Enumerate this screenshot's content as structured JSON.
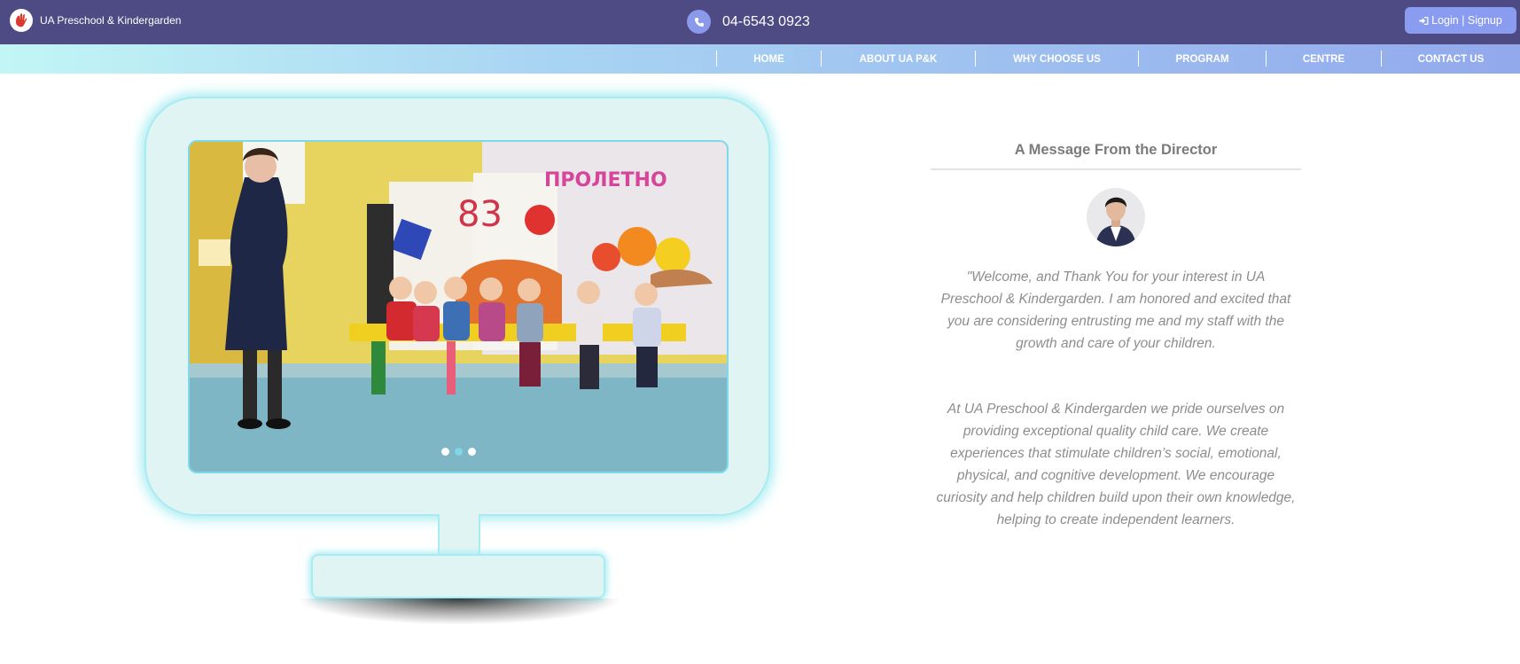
{
  "header": {
    "brand_name": "UA Preschool & Kindergarden",
    "logo_icon": "hand-logo-icon",
    "phone_icon": "phone-icon",
    "phone_number": "04-6543 0923",
    "login_icon": "sign-in-icon",
    "login_label": "Login | Signup"
  },
  "nav": {
    "items": [
      {
        "label": "HOME"
      },
      {
        "label": "ABOUT UA P&K"
      },
      {
        "label": "WHY CHOOSE US"
      },
      {
        "label": "PROGRAM"
      },
      {
        "label": "CENTRE"
      },
      {
        "label": "CONTACT US"
      }
    ]
  },
  "slider": {
    "slide_count": 3,
    "active_slide": 2,
    "classroom_letters": "ПРОЛЕТНО",
    "classroom_number": "83"
  },
  "director": {
    "title": "A Message From the Director",
    "paragraph_1": "\"Welcome, and Thank You for your interest in UA Preschool & Kindergarden. I am honored and excited that you are considering entrusting me and my staff with the growth and care of your children.",
    "paragraph_2": "At UA Preschool & Kindergarden we pride ourselves on providing exceptional quality child care. We create experiences that stimulate children’s social, emotional, physical, and cognitive development. We encourage curiosity and help children build upon their own knowledge, helping to create independent learners."
  },
  "colors": {
    "topbar": "#4e4a83",
    "accent": "#8a9cf0",
    "monitor_fill": "#e1f4f4",
    "monitor_glow": "#a7ecf2"
  }
}
